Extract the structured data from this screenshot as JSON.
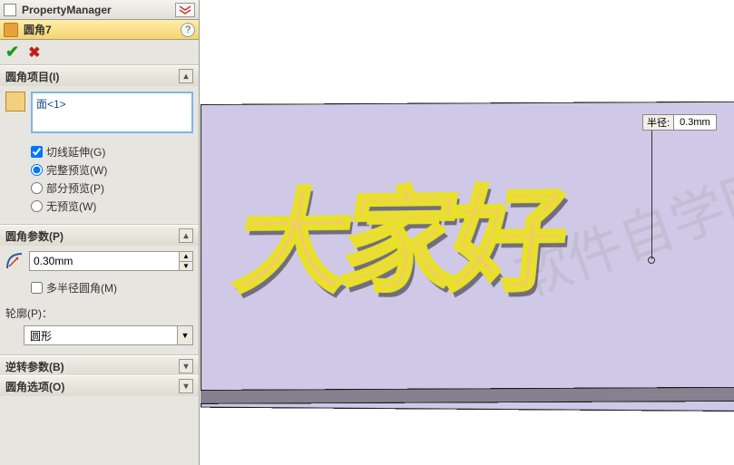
{
  "header": {
    "title": "PropertyManager"
  },
  "feature": {
    "name": "圆角7",
    "help": "?"
  },
  "sections": {
    "items": {
      "title": "圆角项目(I)",
      "selection": [
        "面<1>"
      ],
      "tangent": "切线延伸(G)",
      "full_preview": "完整预览(W)",
      "partial_preview": "部分预览(P)",
      "no_preview": "无预览(W)"
    },
    "params": {
      "title": "圆角参数(P)",
      "radius_value": "0.30mm",
      "multi_radius": "多半径圆角(M)",
      "profile_label": "轮廓(P)：",
      "profile_value": "圆形"
    },
    "reverse": {
      "title": "逆转参数(B)"
    },
    "options": {
      "title": "圆角选项(O)"
    }
  },
  "viewport": {
    "callout_label": "半径:",
    "callout_value": "0.3mm",
    "extruded_text": "大家好",
    "watermark": "软件自学网"
  }
}
